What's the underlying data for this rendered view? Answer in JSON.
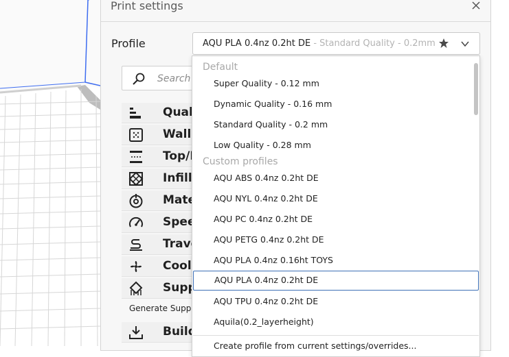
{
  "panel": {
    "title": "Print settings",
    "profile_label": "Profile",
    "profile_current": "AQU PLA 0.4nz 0.2ht DE",
    "profile_current_quality": " - Standard Quality - 0.2mm",
    "search_placeholder": "Search s",
    "categories": [
      {
        "label": "Quali",
        "icon": "quality-icon"
      },
      {
        "label": "Walls",
        "icon": "walls-icon"
      },
      {
        "label": "Top/B",
        "icon": "top-bottom-icon"
      },
      {
        "label": "Infill",
        "icon": "infill-icon"
      },
      {
        "label": "Mate",
        "icon": "material-icon"
      },
      {
        "label": "Speed",
        "icon": "speed-icon"
      },
      {
        "label": "Trave",
        "icon": "travel-icon"
      },
      {
        "label": "Coolin",
        "icon": "cooling-icon"
      },
      {
        "label": "Supp",
        "icon": "support-icon"
      },
      {
        "label": "Build",
        "icon": "build-plate-icon"
      }
    ],
    "generate_support_label": "Generate Suppo"
  },
  "dropdown": {
    "default_header": "Default",
    "default_items": [
      "Super Quality - 0.12 mm",
      "Dynamic Quality - 0.16 mm",
      "Standard Quality - 0.2 mm",
      "Low Quality - 0.28 mm"
    ],
    "custom_header": "Custom profiles",
    "custom_items": [
      "AQU ABS 0.4nz 0.2ht DE",
      "AQU NYL 0.4nz 0.2ht DE",
      "AQU PC 0.4nz 0.2ht DE",
      "AQU PETG 0.4nz 0.2ht DE",
      "AQU PLA 0.4nz 0.16ht TOYS",
      "AQU PLA 0.4nz 0.2ht DE",
      "AQU TPU 0.4nz 0.2ht DE",
      "Aquila(0.2_layerheight)"
    ],
    "selected_item": "AQU PLA 0.4nz 0.2ht DE",
    "footer_action": "Create profile from current settings/overrides..."
  },
  "colors": {
    "accent": "#3c6fb6",
    "grid_line": "#d6d6d6",
    "plate_edge": "#bdbdbd",
    "viewport_axis": "#3d6cf0"
  }
}
